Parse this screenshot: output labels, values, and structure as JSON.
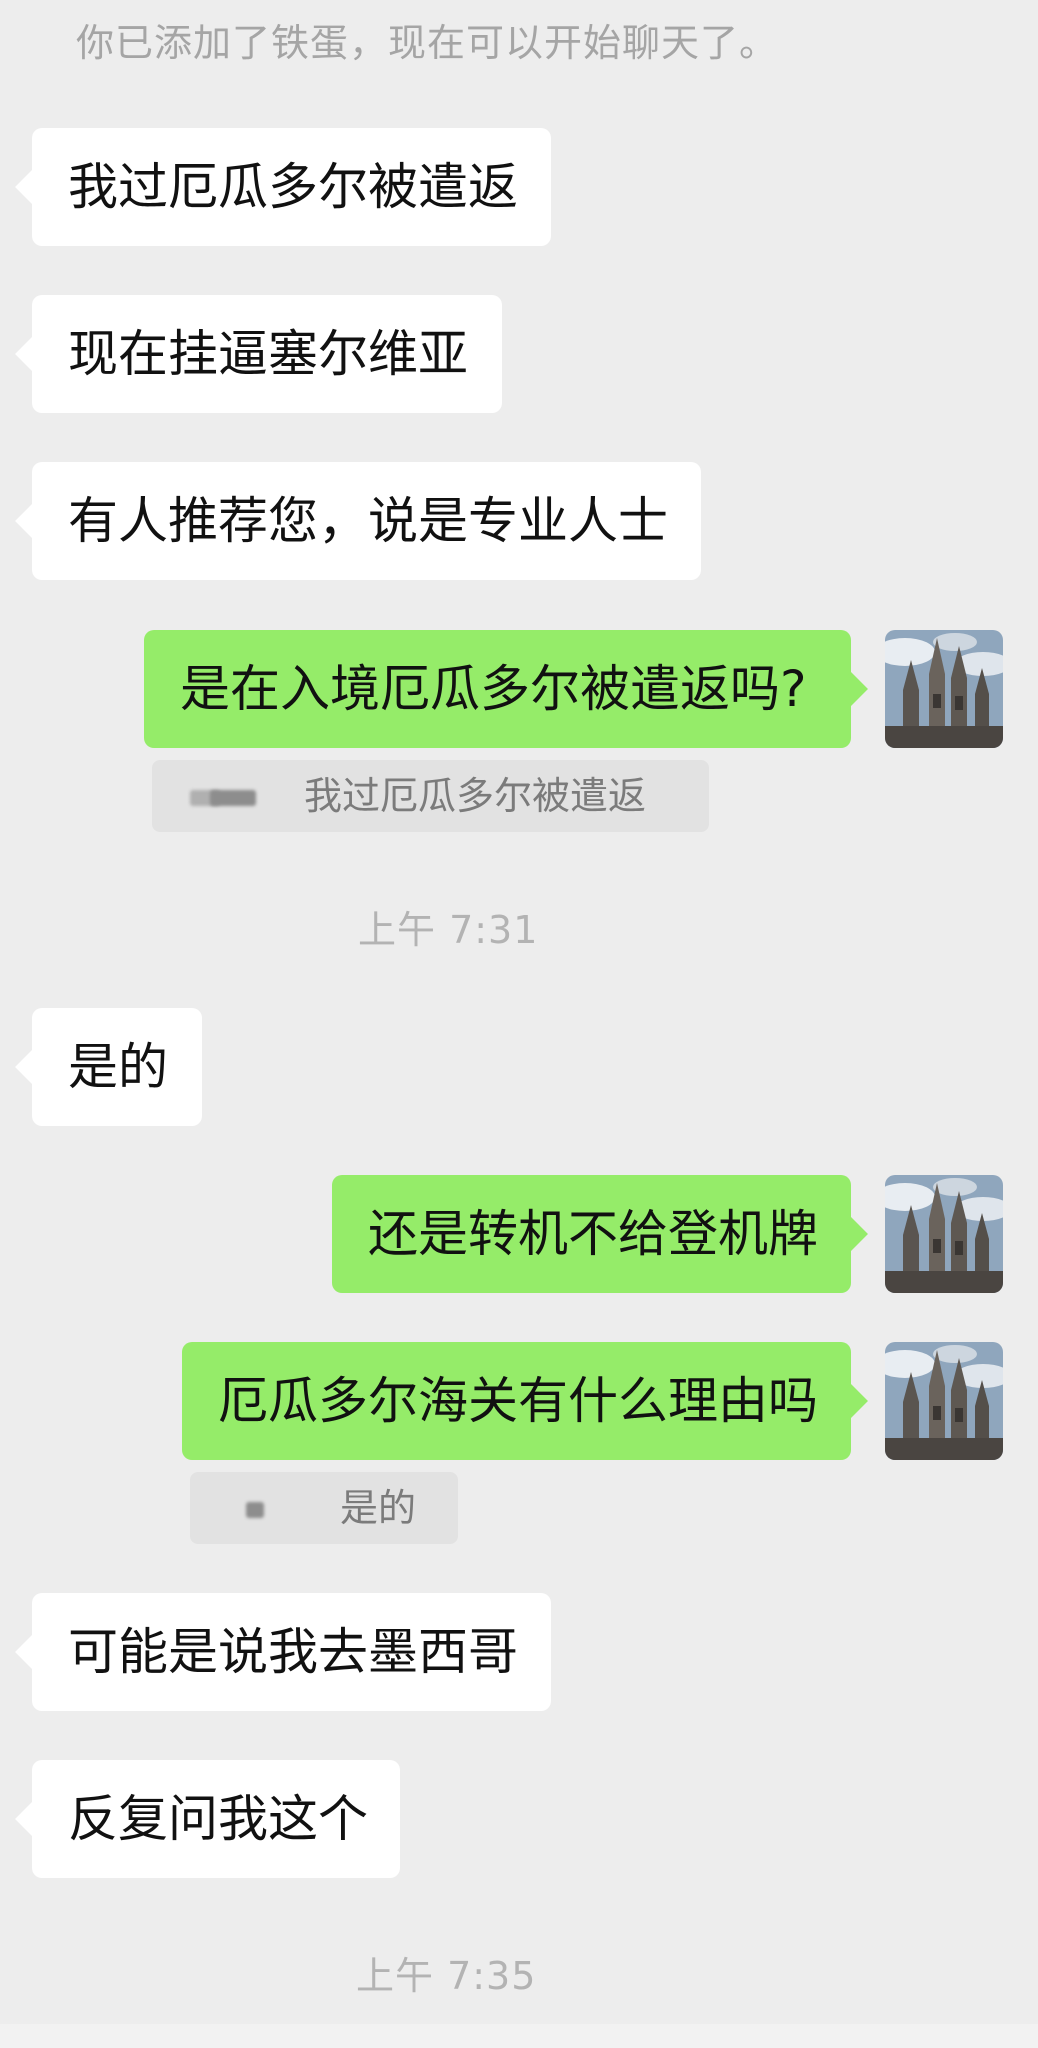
{
  "system_notice": "你已添加了铁蛋，现在可以开始聊天了。",
  "messages": [
    {
      "side": "in",
      "text": "我过厄瓜多尔被遣返"
    },
    {
      "side": "in",
      "text": "现在挂逼塞尔维亚"
    },
    {
      "side": "in",
      "text": "有人推荐您，说是专业人士"
    },
    {
      "side": "out",
      "text": "是在入境厄瓜多尔被遣返吗?",
      "quote": "我过厄瓜多尔被遣返"
    },
    {
      "side": "in",
      "text": "是的"
    },
    {
      "side": "out",
      "text": "还是转机不给登机牌"
    },
    {
      "side": "out",
      "text": "厄瓜多尔海关有什么理由吗",
      "quote": "是的"
    },
    {
      "side": "in",
      "text": "可能是说我去墨西哥"
    },
    {
      "side": "in",
      "text": "反复问我这个"
    }
  ],
  "timestamps": [
    "上午 7:31",
    "上午 7:35"
  ],
  "colors": {
    "background": "#ededed",
    "incoming_bubble": "#ffffff",
    "outgoing_bubble": "#95ec69",
    "quote_background": "#e2e2e2"
  },
  "avatar_icon": "cathedral-photo-avatar"
}
